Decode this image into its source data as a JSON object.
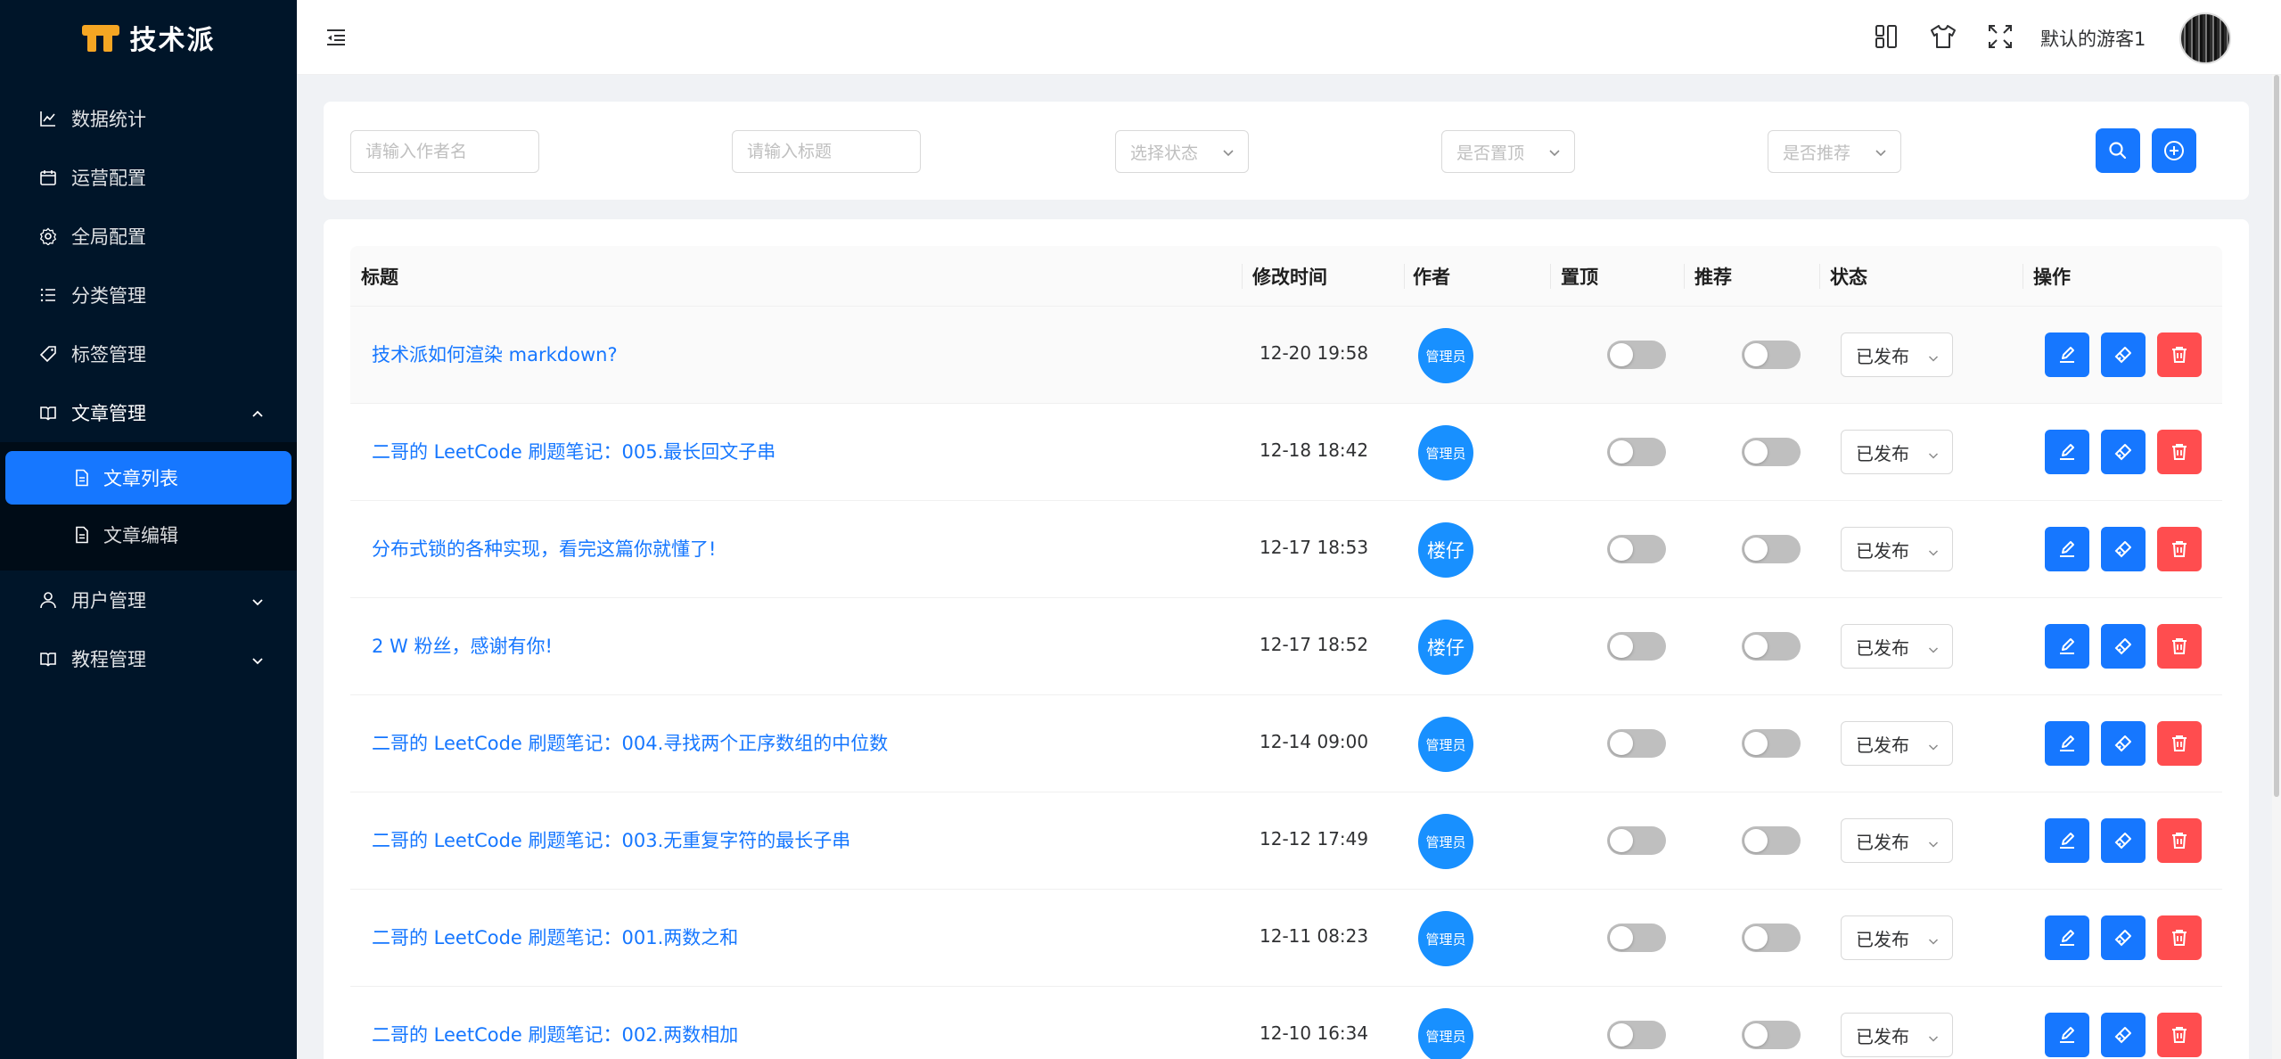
{
  "app": {
    "logo_text": "技术派"
  },
  "sidebar": {
    "items": [
      {
        "label": "数据统计",
        "icon": "line-chart-icon"
      },
      {
        "label": "运营配置",
        "icon": "calendar-icon"
      },
      {
        "label": "全局配置",
        "icon": "gear-icon"
      },
      {
        "label": "分类管理",
        "icon": "list-icon"
      },
      {
        "label": "标签管理",
        "icon": "tag-icon"
      },
      {
        "label": "文章管理",
        "icon": "book-icon",
        "expanded": true
      },
      {
        "label": "用户管理",
        "icon": "user-icon"
      },
      {
        "label": "教程管理",
        "icon": "book-icon"
      }
    ],
    "article_submenu": [
      {
        "label": "文章列表",
        "active": true
      },
      {
        "label": "文章编辑",
        "active": false
      }
    ]
  },
  "header": {
    "user_name": "默认的游客1",
    "icons": [
      "layout-icon",
      "tshirt-icon",
      "fullscreen-icon"
    ]
  },
  "filters": {
    "author_placeholder": "请输入作者名",
    "title_placeholder": "请输入标题",
    "status_placeholder": "选择状态",
    "top_placeholder": "是否置顶",
    "recommend_placeholder": "是否推荐"
  },
  "table": {
    "columns": [
      "标题",
      "修改时间",
      "作者",
      "置顶",
      "推荐",
      "状态",
      "操作"
    ],
    "rows": [
      {
        "title": "技术派如何渲染 markdown?",
        "time": "12-20 19:58",
        "author": "管理员",
        "top": false,
        "recommend": false,
        "status": "已发布"
      },
      {
        "title": "二哥的 LeetCode 刷题笔记：005.最长回文子串",
        "time": "12-18 18:42",
        "author": "管理员",
        "top": false,
        "recommend": false,
        "status": "已发布"
      },
      {
        "title": "分布式锁的各种实现，看完这篇你就懂了!",
        "time": "12-17 18:53",
        "author": "楼仔",
        "top": false,
        "recommend": false,
        "status": "已发布"
      },
      {
        "title": "2 W 粉丝，感谢有你!",
        "time": "12-17 18:52",
        "author": "楼仔",
        "top": false,
        "recommend": false,
        "status": "已发布"
      },
      {
        "title": "二哥的 LeetCode 刷题笔记：004.寻找两个正序数组的中位数",
        "time": "12-14 09:00",
        "author": "管理员",
        "top": false,
        "recommend": false,
        "status": "已发布"
      },
      {
        "title": "二哥的 LeetCode 刷题笔记：003.无重复字符的最长子串",
        "time": "12-12 17:49",
        "author": "管理员",
        "top": false,
        "recommend": false,
        "status": "已发布"
      },
      {
        "title": "二哥的 LeetCode 刷题笔记：001.两数之和",
        "time": "12-11 08:23",
        "author": "管理员",
        "top": false,
        "recommend": false,
        "status": "已发布"
      },
      {
        "title": "二哥的 LeetCode 刷题笔记：002.两数相加",
        "time": "12-10 16:34",
        "author": "管理员",
        "top": false,
        "recommend": false,
        "status": "已发布"
      }
    ]
  },
  "colors": {
    "primary": "#1677ff",
    "danger": "#ff4d4f",
    "sidebar": "#001529"
  }
}
